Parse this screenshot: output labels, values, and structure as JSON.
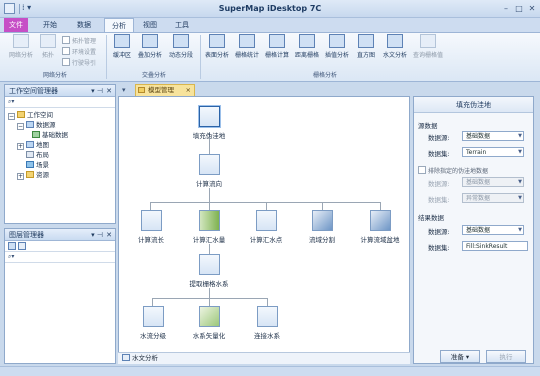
{
  "window": {
    "title": "SuperMap iDesktop 7C",
    "quick_access": "⁞ ▾"
  },
  "tabs": [
    "文件",
    "开始",
    "数据",
    "分析",
    "视图",
    "工具"
  ],
  "ribbon": {
    "topo_group": {
      "label": "网络分析",
      "buttons": [
        "网络分析",
        "拓扑"
      ],
      "checks": [
        "拓扑管理",
        "环境设置",
        "行驶导引"
      ]
    },
    "overlay_group": {
      "label": "交叠分析",
      "buttons": [
        "缓冲区",
        "叠加分析",
        "动态分段"
      ]
    },
    "raster_group": {
      "label": "栅格分析",
      "buttons": [
        "表面分析",
        "栅格统计",
        "栅格计算",
        "距离栅格",
        "插值分析",
        "直方图",
        "水文分析",
        "查询栅格值"
      ]
    }
  },
  "workspace_panel": {
    "title": "工作空间管理器",
    "tree": [
      "工作空间",
      "数据源",
      "基础数据",
      "地图",
      "布局",
      "场景",
      "资源"
    ]
  },
  "layers_panel": {
    "title": "图层管理器"
  },
  "doc_tab": {
    "label": "模型管理",
    "close": "×"
  },
  "model": {
    "nodes": {
      "fill": "填充伪洼地",
      "flowdir": "计算流向",
      "flowlen": "计算流长",
      "accum": "计算汇水量",
      "basin": "计算汇水点",
      "watershed": "流域分割",
      "streamorder": "计算流域盆地",
      "extract": "提取栅格水系",
      "link": "水流分级",
      "vector": "水系矢量化",
      "order": "连接水系"
    },
    "bottom_tab": "水文分析"
  },
  "right_panel": {
    "title": "填充伪洼地",
    "source_section": "源数据",
    "source_ds_label": "数据源:",
    "source_ds_value": "基础数据",
    "source_dt_label": "数据集:",
    "source_dt_value": "Terrain",
    "exclude_check": "排除指定的伪洼地数据",
    "ex_ds_label": "数据源:",
    "ex_ds_value": "基础数据",
    "ex_dt_label": "数据集:",
    "ex_dt_value": "异常数据",
    "result_section": "结果数据",
    "res_ds_label": "数据源:",
    "res_ds_value": "基础数据",
    "res_dt_label": "数据集:",
    "res_dt_value": "Fill:SinkResult",
    "ready_btn": "准备",
    "exec_btn": "执行"
  },
  "colors": {
    "file_tab": "#c64fc6",
    "doc_tab": "#f7e39c",
    "accent": "#2b63a8"
  }
}
